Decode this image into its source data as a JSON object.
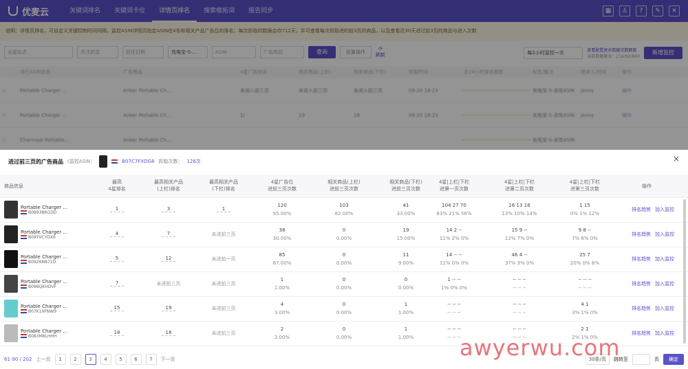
{
  "nav": {
    "brand": "优麦云",
    "tabs": [
      "关键词排名",
      "关键词卡位",
      "详情页排名",
      "搜索框拓词",
      "报告同步"
    ],
    "active_tab": 2,
    "icons": [
      "grid-icon",
      "user-icon",
      "help-icon",
      "settings-icon",
      "close-icon"
    ]
  },
  "notice": "说明：详情页排名，可自定义关键控制时间间隔，监控ASIN详情页指定ASIN在4车和相关产品广告位的排名；每次抓取的数据会存712天，并可查看每次抓取进的前3页的商品，以及查看近30天进过前3页的商品与进入次数",
  "filters": {
    "selects": [
      "全部站点",
      "关注状态",
      "前往日期",
      "充电宝-S-...",
      "ASIN",
      "广告商品"
    ],
    "query_button": "查询",
    "batch_button": "批量操作",
    "refresh_label": "刷新",
    "frequency": "每2小时监控一次",
    "upgrade_link": "查看配置更多数据次数额度",
    "remaining": "当前数据剩余：216/92/800",
    "add_button": "新增监控"
  },
  "bg_table": {
    "headers": [
      "",
      "排行ASIN信息",
      "广告商品",
      "4星广告排名",
      "相关商品(上栏)",
      "相关商品(下栏)",
      "抓取时间",
      "近24小时排名趋势",
      "标签/备注",
      "团体人/时间",
      "操作"
    ],
    "rows": [
      {
        "asin_title": "Portable Charger ...",
        "asin": "B09B3GC8R",
        "ad": "Anker Portable Ch...",
        "ad_asin": "B06TW4CR1",
        "r1": "未进入前三页",
        "r2": "未进入前三页",
        "r3": "未进入前三页",
        "time": "09-20 18:23",
        "time2": "09-21 09:23",
        "tag": "充电宝-S-进攻ASIN",
        "user": "jenny",
        "utime": "09-05 02:05",
        "op": "操作"
      },
      {
        "asin_title": "Portable Charger ...",
        "asin": "B09B3GC8R",
        "ad": "Anker Portable Ch...",
        "ad_asin": "B07Q8VBN18",
        "r1": "1/",
        "r2": "19",
        "r3": "16",
        "time": "09-20 18:23",
        "time2": "09-21 09:23",
        "tag": "充电宝-S-进攻ASIN",
        "user": "jenny",
        "utime": "09-05 02:05",
        "op": "操作"
      },
      {
        "asin_title": "Charmast Portable...",
        "asin": "",
        "ad": "Anker Portable Ch...",
        "ad_asin": "",
        "r1": "",
        "r2": "",
        "r3": "",
        "time": "",
        "time2": "",
        "tag": "充电宝-S-进攻ASIN",
        "user": "",
        "utime": "",
        "op": ""
      }
    ]
  },
  "modal": {
    "title": "进过前三页的广告商品",
    "asin_label": "(监控ASIN：",
    "asin": "B07C7FXDG8",
    "count_label": "抓取次数：",
    "count": "126次",
    "close": "×",
    "headers": [
      [
        "商品信息",
        ""
      ],
      [
        "最高",
        "4星排名"
      ],
      [
        "最高相关产品",
        "(上栏)排名"
      ],
      [
        "最高相关产品",
        "(下栏)排名"
      ],
      [
        "4星广告位",
        "进前三页次数"
      ],
      [
        "相关商品(上栏)",
        "进前三页次数"
      ],
      [
        "相关商品(下栏)",
        "进前三页次数"
      ],
      [
        "4星|上栏|下栏",
        "进第一页次数"
      ],
      [
        "4星|上栏|下栏",
        "进第二页次数"
      ],
      [
        "4星|上栏|下栏",
        "进第三页次数"
      ],
      [
        "操作",
        ""
      ]
    ],
    "rows": [
      {
        "title": "Portable Charger ...",
        "asin": "B0B93BN1DD",
        "img": "#333",
        "r4": "1",
        "rup": "3",
        "rdown": "1",
        "c4": "120",
        "c4p": "95.00%",
        "cup": "103",
        "cupp": "82.00%",
        "cdown": "41",
        "cdownp": "33.00%",
        "p1": "104 27 70",
        "p1p": "83% 21% 56%",
        "p2": "16 13 18",
        "p2p": "13% 10% 14%",
        "p3": "1 15",
        "p3p": "0% 1% 12%"
      },
      {
        "title": "Portable Charger ...",
        "asin": "B09YVCYDX6",
        "img": "#222",
        "r4": "4",
        "rup": "7",
        "rdown": "未进前三页",
        "c4": "38",
        "c4p": "30.00%",
        "cup": "0",
        "cupp": "0.00%",
        "cdown": "19",
        "cdownp": "15.00%",
        "p1": "14 2 --",
        "p1p": "11% 2% 0%",
        "p2": "15 9 --",
        "p2p": "12% 7% 0%",
        "p3": "9 8 --",
        "p3p": "7% 6% 0%"
      },
      {
        "title": "Portable Charger ...",
        "asin": "B09Z6N871D",
        "img": "#111",
        "r4": "5",
        "rup": "12",
        "rdown": "未进前一页",
        "c4": "85",
        "c4p": "67.00%",
        "cup": "0",
        "cupp": "0.00%",
        "cdown": "11",
        "cdownp": "9.00%",
        "p1": "14 -- --",
        "p1p": "11% 0% 0%",
        "p2": "46 4 --",
        "p2p": "37% 3% 0%",
        "p3": "25 7",
        "p3p": "20% 0% 6%"
      },
      {
        "title": "Portable Charger ...",
        "asin": "B09BQKHDVF",
        "img": "#444",
        "r4": "7",
        "rup": "未进前三页",
        "rdown": "未进前三页",
        "c4": "1",
        "c4p": "1.00%",
        "cup": "0",
        "cupp": "0.00%",
        "cdown": "0",
        "cdownp": "0.00%",
        "p1": "1 -- --",
        "p1p": "1% 0% 0%",
        "p2": "-- -- --",
        "p2p": "-- -- --",
        "p3": "-- -- --",
        "p3p": "-- -- --"
      },
      {
        "title": "Portable Charger ...",
        "asin": "B07K19FNW9",
        "img": "#6cc",
        "r4": "15",
        "rup": "19",
        "rdown": "未进前三页",
        "c4": "4",
        "c4p": "3.00%",
        "cup": "0",
        "cupp": "0.00%",
        "cdown": "1",
        "cdownp": "1.00%",
        "p1": "-- -- --",
        "p1p": "-- -- --",
        "p2": "-- -- --",
        "p2p": "-- -- --",
        "p3": "4 1",
        "p3p": "3% 1% 0%"
      },
      {
        "title": "Portable Charger ...",
        "asin": "B083M8LHHH",
        "img": "#bbb",
        "r4": "18",
        "rup": "18",
        "rdown": "未进前三页",
        "c4": "2",
        "c4p": "2.00%",
        "cup": "0",
        "cupp": "0.00%",
        "cdown": "1",
        "cdownp": "1.00%",
        "p1": "-- -- --",
        "p1p": "-- -- --",
        "p2": "-- -- --",
        "p2p": "-- -- --",
        "p3": "2 1",
        "p3p": "2% 1% 0%"
      }
    ],
    "op_trend": "排名趋势",
    "op_add": "加入监控"
  },
  "pager": {
    "range": "61-90 / 202",
    "prev": "上一页",
    "pages": [
      "1",
      "2",
      "3",
      "4",
      "5",
      "6",
      "7"
    ],
    "active": 2,
    "next": "下一页",
    "size": "30条/页",
    "goto": "跳转至",
    "unit": "页",
    "ok": "确定"
  },
  "watermark": "awyerwu.com",
  "colors": {
    "accent": "#5b52c8",
    "notice_bg": "#fdf6e3"
  }
}
